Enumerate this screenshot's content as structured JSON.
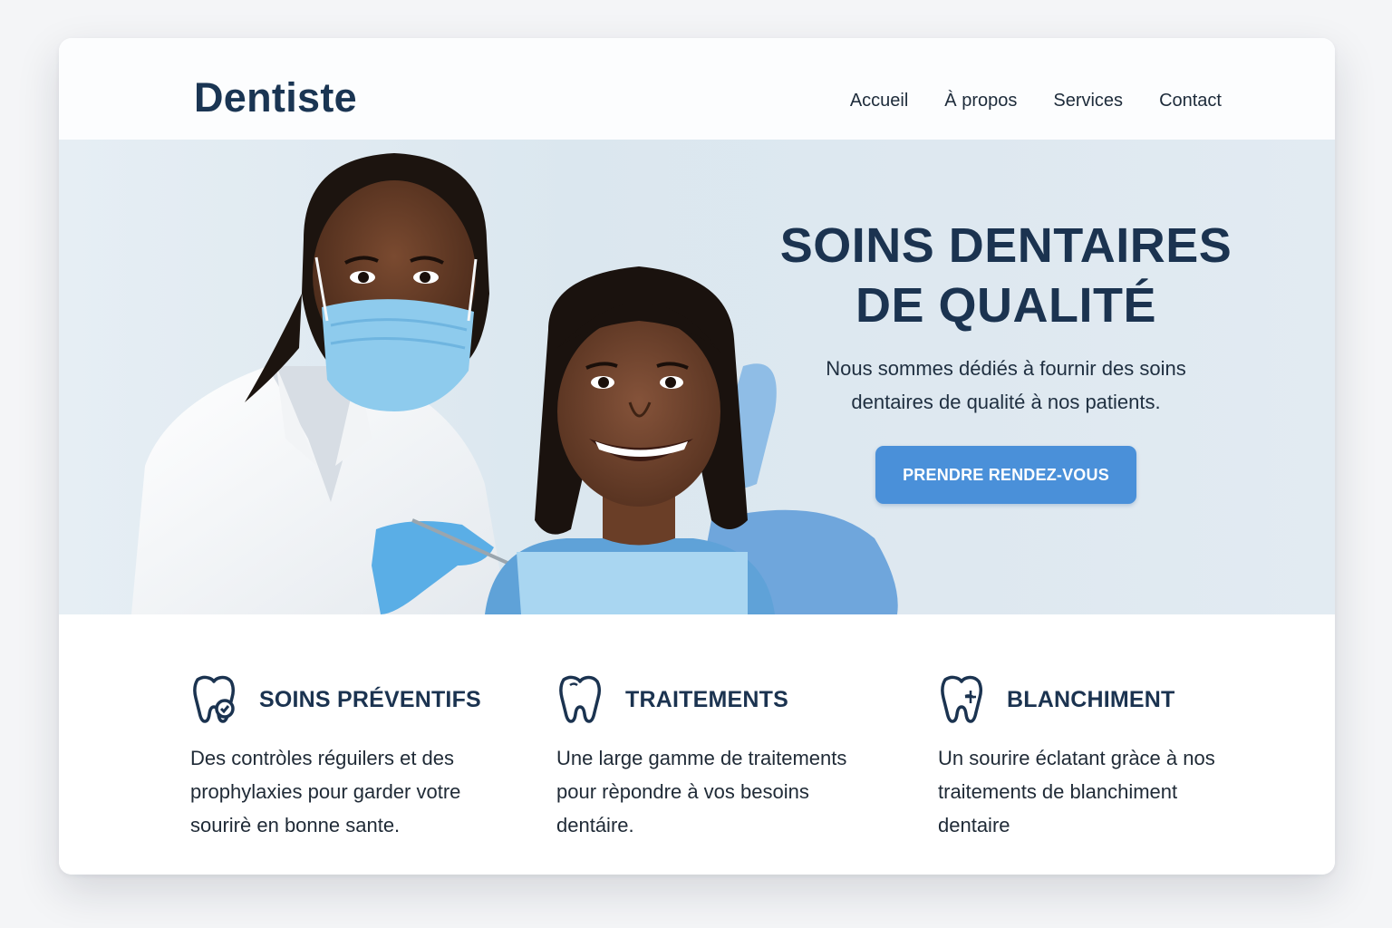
{
  "header": {
    "logo": "Dentiste",
    "nav": [
      "Accueil",
      "À propos",
      "Services",
      "Contact"
    ]
  },
  "hero": {
    "title_line1": "SOINS DENTAIRES",
    "title_line2": "DE QUALITÉ",
    "subtitle_line1": "Nous sommes dédiés à fournir des soins",
    "subtitle_line2": "dentaires de qualité à nos patients.",
    "cta": "PRENDRE RENDEZ-VOUS"
  },
  "services": [
    {
      "title": "SOINS PRÉVENTIFS",
      "icon": "tooth-check-icon",
      "lines": [
        "Des contròles réguilers et des",
        "prophylaxies pour garder votre",
        "sourirè en bonne sante."
      ]
    },
    {
      "title": "TRAITEMENTS",
      "icon": "tooth-icon",
      "lines": [
        "Une large gamme de traitements",
        "pour rèpondre à vos besoins",
        "dentáire."
      ]
    },
    {
      "title": "BLANCHIMENT",
      "icon": "tooth-sparkle-icon",
      "lines": [
        "Un sourire éclatant gràce à nos",
        "traitements de blanchiment",
        "dentaire"
      ]
    }
  ],
  "colors": {
    "brand": "#1b3350",
    "accent": "#4a90d9",
    "hero_bg": "#dde8f0"
  }
}
